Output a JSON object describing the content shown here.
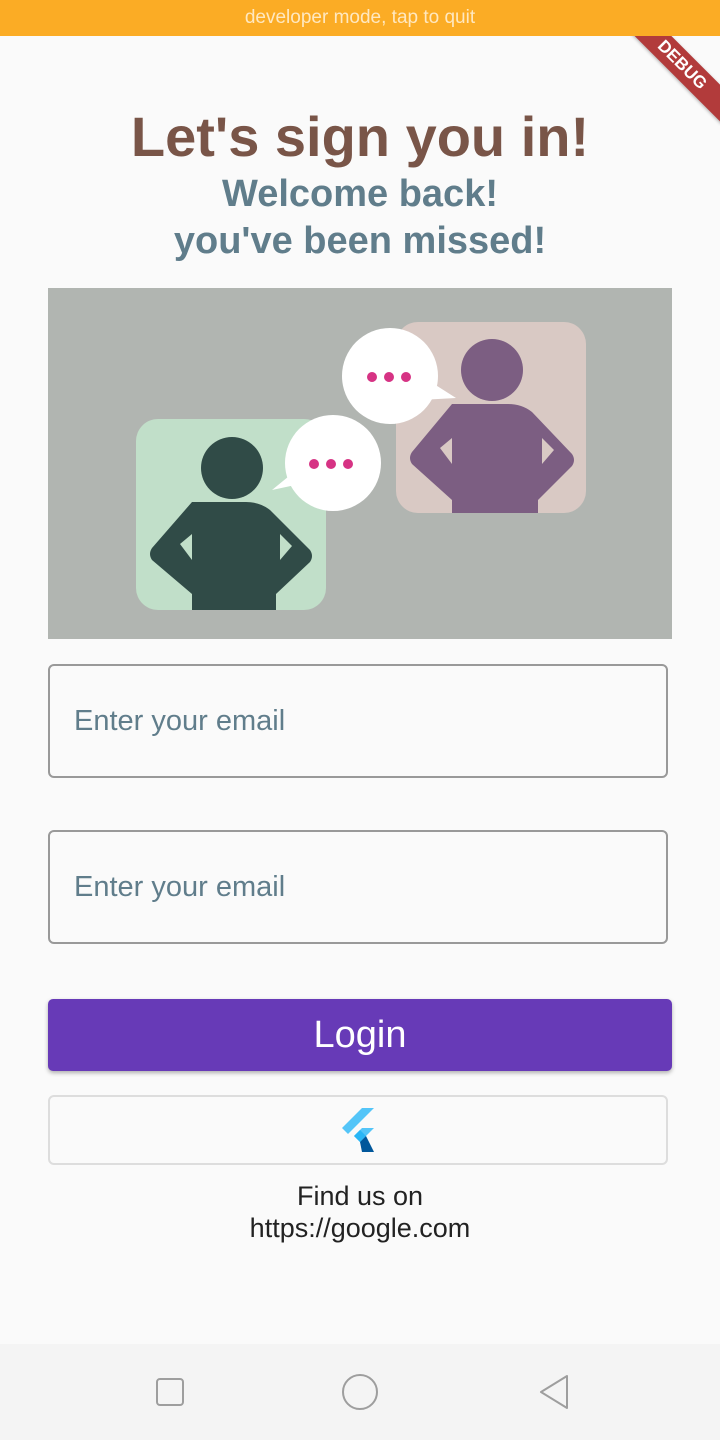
{
  "status_banner": "developer mode, tap to quit",
  "debug_ribbon": "DEBUG",
  "header": {
    "title": "Let's sign you in!",
    "subtitle_line1": "Welcome back!",
    "subtitle_line2": "you've been missed!"
  },
  "illustration": {
    "name": "two-people-chatting-illustration",
    "background": "#b1b5b1"
  },
  "form": {
    "email_placeholder": "Enter your email",
    "second_placeholder": "Enter your email"
  },
  "buttons": {
    "login_label": "Login",
    "flutter_icon": "flutter-logo-icon"
  },
  "footer": {
    "line1": "Find us on",
    "line2": "https://google.com"
  },
  "navbar": {
    "icons": [
      "recents-square-icon",
      "home-circle-icon",
      "back-triangle-icon"
    ]
  },
  "colors": {
    "title": "#795548",
    "subtitle": "#607d8b",
    "accent": "#673ab7",
    "banner": "#fbac25"
  }
}
